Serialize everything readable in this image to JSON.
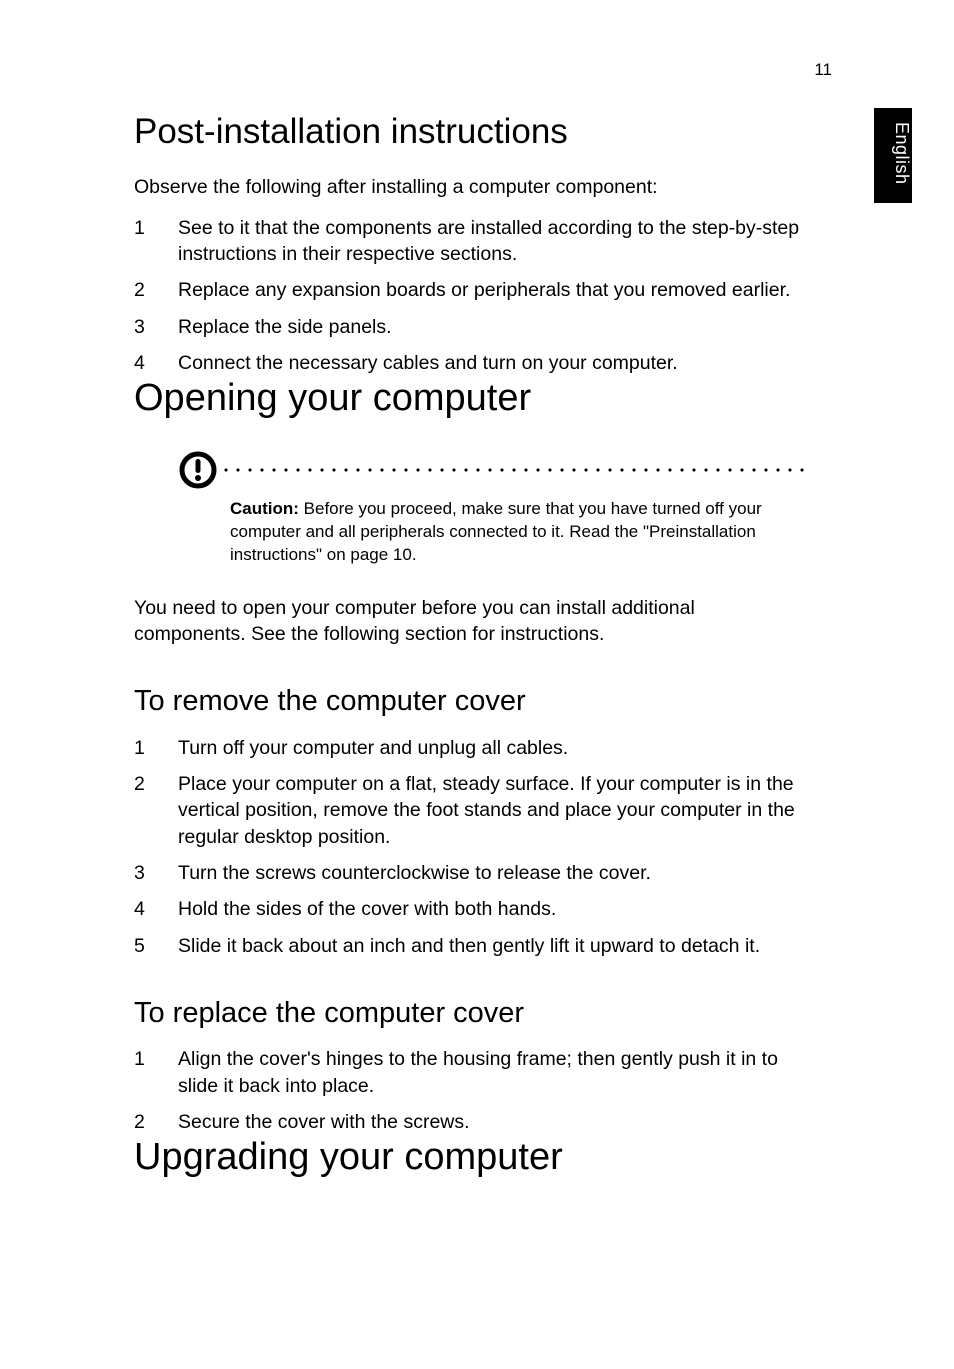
{
  "page_number": "11",
  "side_tab": "English",
  "section_post_install": {
    "heading": "Post-installation instructions",
    "intro": "Observe the following after installing a computer component:",
    "items": [
      "See to it that the components are installed according to the step-by-step instructions in their respective sections.",
      "Replace any expansion boards or peripherals that you removed earlier.",
      "Replace the side panels.",
      "Connect the necessary cables and turn on your computer."
    ]
  },
  "section_opening": {
    "heading": "Opening your computer",
    "caution_label": "Caution:",
    "caution_text": " Before you proceed, make sure that you have turned off your computer and all peripherals connected to it. Read the \"Preinstallation instructions\" on page 10.",
    "body": "You need to open your computer before you can install additional components.  See the following section for instructions."
  },
  "section_remove": {
    "heading": "To remove the computer cover",
    "items": [
      "Turn off your computer and unplug all cables.",
      "Place your computer on a flat, steady surface. If your computer is in the vertical position, remove the foot stands and place your computer in the regular desktop position.",
      "Turn the screws counterclockwise to release the cover.",
      "Hold the sides of the cover with both hands.",
      "Slide it back about an inch and then gently lift it upward to detach it."
    ]
  },
  "section_replace": {
    "heading": "To replace the computer cover",
    "items": [
      "Align the cover's hinges to the housing frame; then gently push it in to slide it back into place.",
      "Secure the cover with the screws."
    ]
  },
  "section_upgrading": {
    "heading": "Upgrading your computer"
  }
}
